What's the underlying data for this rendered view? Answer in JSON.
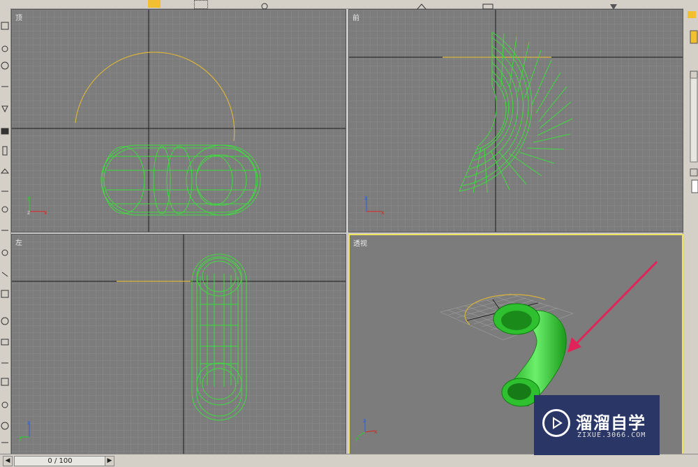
{
  "viewports": {
    "top": {
      "label": "顶"
    },
    "front": {
      "label": "前"
    },
    "left": {
      "label": "左"
    },
    "perspective": {
      "label": "透视",
      "active": true
    }
  },
  "axis_labels": {
    "x": "x",
    "y": "y",
    "z": "z"
  },
  "timeline": {
    "frame_display": "0 / 100",
    "prev_icon": "triangle-left-icon",
    "next_icon": "triangle-right-icon"
  },
  "watermark": {
    "title": "溜溜自学",
    "subtitle": "ZIXUE.3066.COM"
  },
  "colors": {
    "viewport_bg": "#7c7c7c",
    "grid": "#8a8a8a",
    "axis_line": "#1a1a1a",
    "wireframe": "#3fdc3f",
    "arc": "#d8b43a",
    "active_border": "#f0e060",
    "arrow": "#e0245a"
  }
}
